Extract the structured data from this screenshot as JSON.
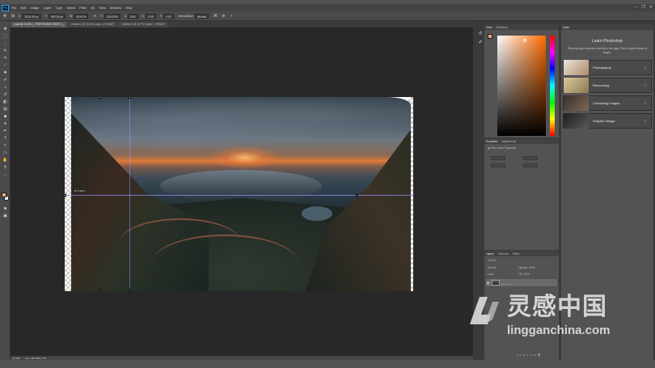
{
  "app": {
    "logo": "Ps",
    "menus": [
      "File",
      "Edit",
      "Image",
      "Layer",
      "Type",
      "Select",
      "Filter",
      "3D",
      "View",
      "Window",
      "Help"
    ],
    "window_controls": [
      "–",
      "❐",
      "✕"
    ]
  },
  "options": {
    "x_label": "X:",
    "x_value": "1210.00 px",
    "y_label": "Y:",
    "y_value": "940.00 px",
    "w_label": "W:",
    "w_value": "93.67%",
    "h_label": "H:",
    "h_value": "100.00%",
    "angle_label": "∠",
    "angle_value": "0.00",
    "hskew_label": "H:",
    "hskew_value": "0.00",
    "vskew_label": "V:",
    "vskew_value": "0.00",
    "interp_label": "Interpolation:",
    "interp_value": "Bicubic"
  },
  "tabs": [
    "2.psd @ 16.6% (...TRETHCHING RIGHT...)",
    "Untitled-1 @ 16.6% (Layer 1, RGB/8*)",
    "Untitled-2 @ 16.7% (Layer 1, RGB/8*)"
  ],
  "canvas": {
    "measure_label": "W: 0.00 in"
  },
  "status": {
    "zoom": "16.68%",
    "doc": "Doc: 282.8M/1.37G"
  },
  "color_panel": {
    "tabs": [
      "Color",
      "Swatches"
    ]
  },
  "learn_panel": {
    "tab": "Learn",
    "title": "Learn Photoshop",
    "subtitle": "Step-by-step tutorials directly in the app. Pick a topic below to begin.",
    "items": [
      "Photography",
      "Retouching",
      "Combining Images",
      "Graphic Design"
    ]
  },
  "properties_panel": {
    "tabs": [
      "Properties",
      "Adjustments"
    ],
    "header": "Pixel Layer Properties"
  },
  "layers_panel": {
    "tabs": [
      "Layers",
      "Channels",
      "Paths"
    ],
    "kind_label": "Kind",
    "blend_mode": "Normal",
    "opacity_label": "Opacity:",
    "opacity_value": "100%",
    "lock_label": "Lock:",
    "fill_label": "Fill:",
    "fill_value": "100%",
    "layer_name": "___ ____"
  },
  "watermark": {
    "cn": "灵感中国",
    "url": "lingganchina.com"
  },
  "colors": {
    "foreground": "#e8a776",
    "background": "#f4f4f4",
    "ps_accent": "#31a8ff"
  }
}
